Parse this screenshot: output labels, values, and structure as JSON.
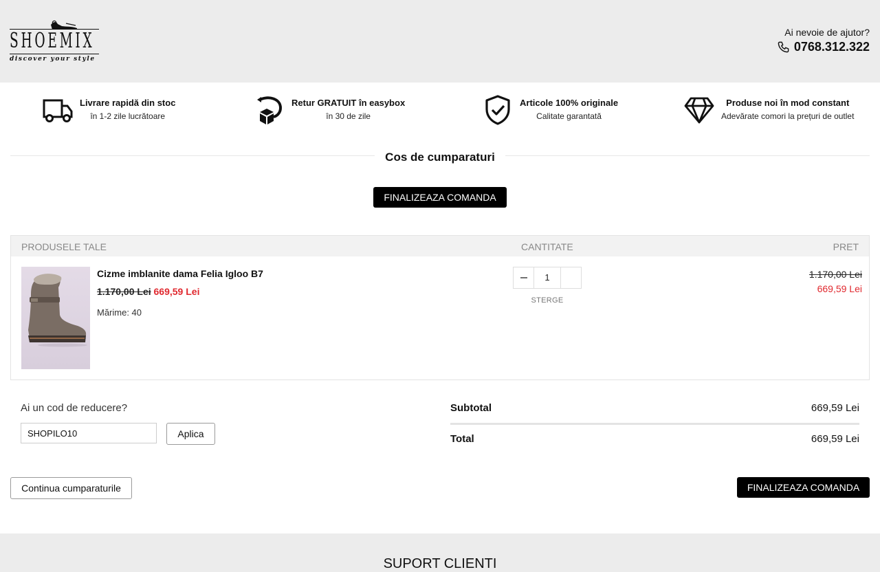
{
  "header": {
    "logo_text": "SHOEMIX",
    "logo_tagline": "discover your style",
    "help_question": "Ai nevoie de ajutor?",
    "phone": "0768.312.322"
  },
  "benefits": [
    {
      "icon": "truck-icon",
      "title": "Livrare rapidă din stoc",
      "subtitle": "în 1-2 zile lucrătoare"
    },
    {
      "icon": "return-box-icon",
      "title": "Retur GRATUIT în easybox",
      "subtitle": "în 30 de zile"
    },
    {
      "icon": "shield-check-icon",
      "title": "Articole 100% originale",
      "subtitle": "Calitate garantată"
    },
    {
      "icon": "diamond-icon",
      "title": "Produse noi în mod constant",
      "subtitle": "Adevărate comori la prețuri de outlet"
    }
  ],
  "page_title": "Cos de cumparaturi",
  "checkout_label": "FINALIZEAZA COMANDA",
  "cart": {
    "headers": {
      "product": "PRODUSELE TALE",
      "quantity": "CANTITATE",
      "price": "PRET"
    },
    "items": [
      {
        "name": "Cizme imblanite dama Felia Igloo B7",
        "old_price": "1.170,00 Lei",
        "new_price": "669,59 Lei",
        "size": "Mărime: 40",
        "quantity": "1",
        "remove_label": "STERGE",
        "line_old_price": "1.170,00 Lei",
        "line_new_price": "669,59 Lei"
      }
    ]
  },
  "discount": {
    "label": "Ai un cod de reducere?",
    "value": "SHOPILO10",
    "apply_label": "Aplica"
  },
  "totals": {
    "subtotal_label": "Subtotal",
    "subtotal_value": "669,59 Lei",
    "total_label": "Total",
    "total_value": "669,59 Lei"
  },
  "continue_label": "Continua cumparaturile",
  "footer": {
    "title": "SUPORT CLIENTI"
  },
  "colors": {
    "accent_price": "#e0282e",
    "header_bg": "#ececec",
    "button_dark": "#000000"
  }
}
